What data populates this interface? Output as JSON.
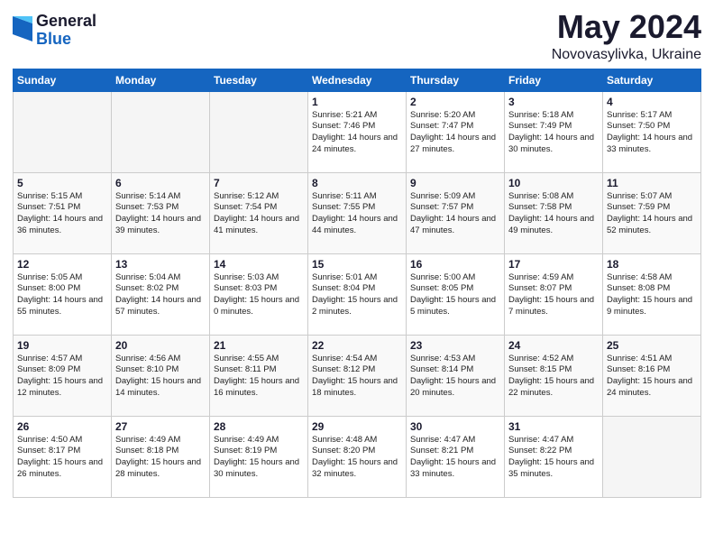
{
  "logo": {
    "general": "General",
    "blue": "Blue"
  },
  "title": "May 2024",
  "subtitle": "Novovasylivka, Ukraine",
  "days_of_week": [
    "Sunday",
    "Monday",
    "Tuesday",
    "Wednesday",
    "Thursday",
    "Friday",
    "Saturday"
  ],
  "weeks": [
    [
      {
        "num": "",
        "info": ""
      },
      {
        "num": "",
        "info": ""
      },
      {
        "num": "",
        "info": ""
      },
      {
        "num": "1",
        "info": "Sunrise: 5:21 AM\nSunset: 7:46 PM\nDaylight: 14 hours\nand 24 minutes."
      },
      {
        "num": "2",
        "info": "Sunrise: 5:20 AM\nSunset: 7:47 PM\nDaylight: 14 hours\nand 27 minutes."
      },
      {
        "num": "3",
        "info": "Sunrise: 5:18 AM\nSunset: 7:49 PM\nDaylight: 14 hours\nand 30 minutes."
      },
      {
        "num": "4",
        "info": "Sunrise: 5:17 AM\nSunset: 7:50 PM\nDaylight: 14 hours\nand 33 minutes."
      }
    ],
    [
      {
        "num": "5",
        "info": "Sunrise: 5:15 AM\nSunset: 7:51 PM\nDaylight: 14 hours\nand 36 minutes."
      },
      {
        "num": "6",
        "info": "Sunrise: 5:14 AM\nSunset: 7:53 PM\nDaylight: 14 hours\nand 39 minutes."
      },
      {
        "num": "7",
        "info": "Sunrise: 5:12 AM\nSunset: 7:54 PM\nDaylight: 14 hours\nand 41 minutes."
      },
      {
        "num": "8",
        "info": "Sunrise: 5:11 AM\nSunset: 7:55 PM\nDaylight: 14 hours\nand 44 minutes."
      },
      {
        "num": "9",
        "info": "Sunrise: 5:09 AM\nSunset: 7:57 PM\nDaylight: 14 hours\nand 47 minutes."
      },
      {
        "num": "10",
        "info": "Sunrise: 5:08 AM\nSunset: 7:58 PM\nDaylight: 14 hours\nand 49 minutes."
      },
      {
        "num": "11",
        "info": "Sunrise: 5:07 AM\nSunset: 7:59 PM\nDaylight: 14 hours\nand 52 minutes."
      }
    ],
    [
      {
        "num": "12",
        "info": "Sunrise: 5:05 AM\nSunset: 8:00 PM\nDaylight: 14 hours\nand 55 minutes."
      },
      {
        "num": "13",
        "info": "Sunrise: 5:04 AM\nSunset: 8:02 PM\nDaylight: 14 hours\nand 57 minutes."
      },
      {
        "num": "14",
        "info": "Sunrise: 5:03 AM\nSunset: 8:03 PM\nDaylight: 15 hours\nand 0 minutes."
      },
      {
        "num": "15",
        "info": "Sunrise: 5:01 AM\nSunset: 8:04 PM\nDaylight: 15 hours\nand 2 minutes."
      },
      {
        "num": "16",
        "info": "Sunrise: 5:00 AM\nSunset: 8:05 PM\nDaylight: 15 hours\nand 5 minutes."
      },
      {
        "num": "17",
        "info": "Sunrise: 4:59 AM\nSunset: 8:07 PM\nDaylight: 15 hours\nand 7 minutes."
      },
      {
        "num": "18",
        "info": "Sunrise: 4:58 AM\nSunset: 8:08 PM\nDaylight: 15 hours\nand 9 minutes."
      }
    ],
    [
      {
        "num": "19",
        "info": "Sunrise: 4:57 AM\nSunset: 8:09 PM\nDaylight: 15 hours\nand 12 minutes."
      },
      {
        "num": "20",
        "info": "Sunrise: 4:56 AM\nSunset: 8:10 PM\nDaylight: 15 hours\nand 14 minutes."
      },
      {
        "num": "21",
        "info": "Sunrise: 4:55 AM\nSunset: 8:11 PM\nDaylight: 15 hours\nand 16 minutes."
      },
      {
        "num": "22",
        "info": "Sunrise: 4:54 AM\nSunset: 8:12 PM\nDaylight: 15 hours\nand 18 minutes."
      },
      {
        "num": "23",
        "info": "Sunrise: 4:53 AM\nSunset: 8:14 PM\nDaylight: 15 hours\nand 20 minutes."
      },
      {
        "num": "24",
        "info": "Sunrise: 4:52 AM\nSunset: 8:15 PM\nDaylight: 15 hours\nand 22 minutes."
      },
      {
        "num": "25",
        "info": "Sunrise: 4:51 AM\nSunset: 8:16 PM\nDaylight: 15 hours\nand 24 minutes."
      }
    ],
    [
      {
        "num": "26",
        "info": "Sunrise: 4:50 AM\nSunset: 8:17 PM\nDaylight: 15 hours\nand 26 minutes."
      },
      {
        "num": "27",
        "info": "Sunrise: 4:49 AM\nSunset: 8:18 PM\nDaylight: 15 hours\nand 28 minutes."
      },
      {
        "num": "28",
        "info": "Sunrise: 4:49 AM\nSunset: 8:19 PM\nDaylight: 15 hours\nand 30 minutes."
      },
      {
        "num": "29",
        "info": "Sunrise: 4:48 AM\nSunset: 8:20 PM\nDaylight: 15 hours\nand 32 minutes."
      },
      {
        "num": "30",
        "info": "Sunrise: 4:47 AM\nSunset: 8:21 PM\nDaylight: 15 hours\nand 33 minutes."
      },
      {
        "num": "31",
        "info": "Sunrise: 4:47 AM\nSunset: 8:22 PM\nDaylight: 15 hours\nand 35 minutes."
      },
      {
        "num": "",
        "info": ""
      }
    ]
  ]
}
